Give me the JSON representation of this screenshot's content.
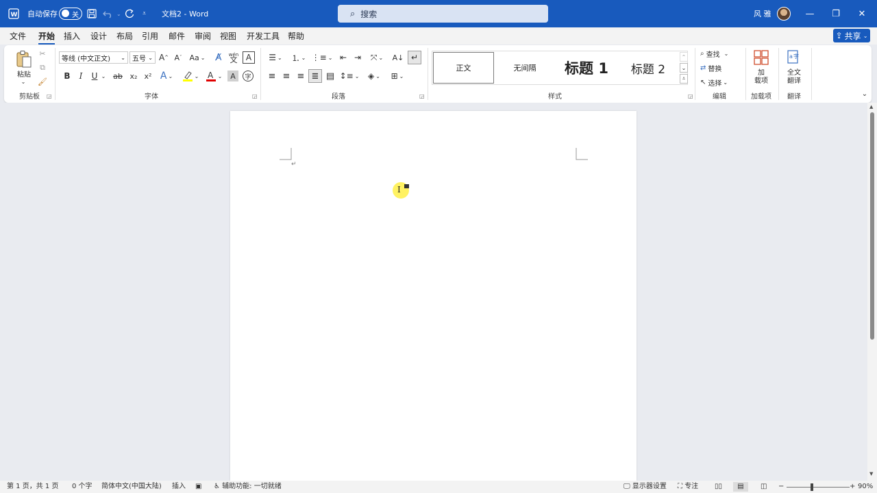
{
  "titlebar": {
    "app_icon": "word-icon",
    "autosave_label": "自动保存",
    "autosave_state": "关",
    "doc_title": "文档2",
    "separator": "-",
    "app_name": "Word",
    "search_placeholder": "搜索",
    "user_name": "风 雅",
    "accent": "#185abd"
  },
  "menu": {
    "items": [
      "文件",
      "开始",
      "插入",
      "设计",
      "布局",
      "引用",
      "邮件",
      "审阅",
      "视图",
      "开发工具",
      "帮助"
    ],
    "active": "开始",
    "share_label": "共享"
  },
  "ribbon": {
    "clipboard": {
      "paste_label": "粘贴",
      "group_label": "剪贴板"
    },
    "font": {
      "font_name": "等线 (中文正文)",
      "font_size": "五号",
      "group_label": "字体",
      "grow": "A^",
      "shrink": "Aˇ",
      "case": "Aa",
      "bold": "B",
      "italic": "I",
      "underline": "U",
      "strike": "ab",
      "subscript": "x₂",
      "superscript": "x²",
      "wen": "wén",
      "highlight_color": "#ffff00",
      "font_color": "#e00000"
    },
    "paragraph": {
      "group_label": "段落"
    },
    "styles": {
      "group_label": "样式",
      "items": [
        "正文",
        "无间隔",
        "标题 1",
        "标题 2"
      ]
    },
    "editing": {
      "find": "查找",
      "replace": "替换",
      "select": "选择",
      "group_label": "编辑"
    },
    "addins": {
      "label_line1": "加",
      "label_line2": "载项",
      "group_label": "加载项"
    },
    "translate": {
      "label_line1": "全文",
      "label_line2": "翻译",
      "group_label": "翻译"
    }
  },
  "statusbar": {
    "page": "第 1 页，共 1 页",
    "words": "0 个字",
    "language": "简体中文(中国大陆)",
    "mode": "插入",
    "accessibility": "辅助功能: 一切就绪",
    "display_settings": "显示器设置",
    "focus": "专注",
    "zoom": "90%"
  }
}
